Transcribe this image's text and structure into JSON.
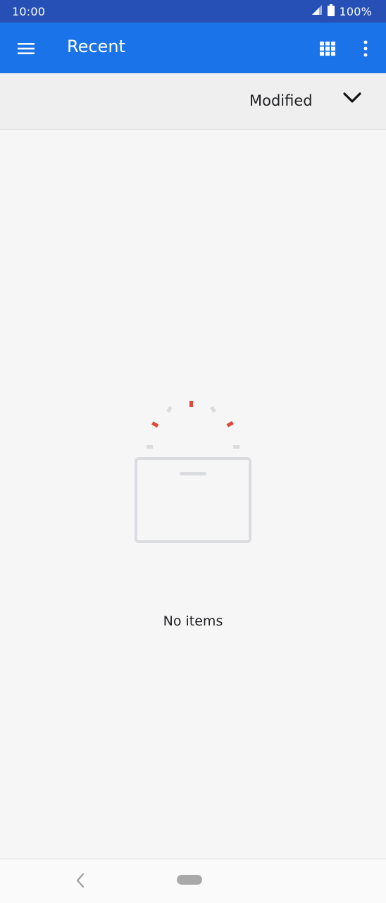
{
  "status_bar": {
    "time": "10:00",
    "battery": "100%",
    "icons": [
      "signal-icon",
      "battery-icon"
    ]
  },
  "app_bar": {
    "title": "Recent",
    "icons": [
      "menu-icon",
      "grid-view-icon",
      "more-vert-icon"
    ]
  },
  "sort": {
    "label": "Modified",
    "icon": "chevron-down-icon"
  },
  "empty_state": {
    "message": "No items",
    "colors": {
      "accent": "#dd4b39",
      "neutral": "#dadce0"
    }
  },
  "nav_bar": {
    "icons": [
      "back-icon",
      "home-pill"
    ]
  },
  "colors": {
    "status_bar": "#2650b5",
    "app_bar": "#1a73e8",
    "background": "#f6f6f6"
  }
}
